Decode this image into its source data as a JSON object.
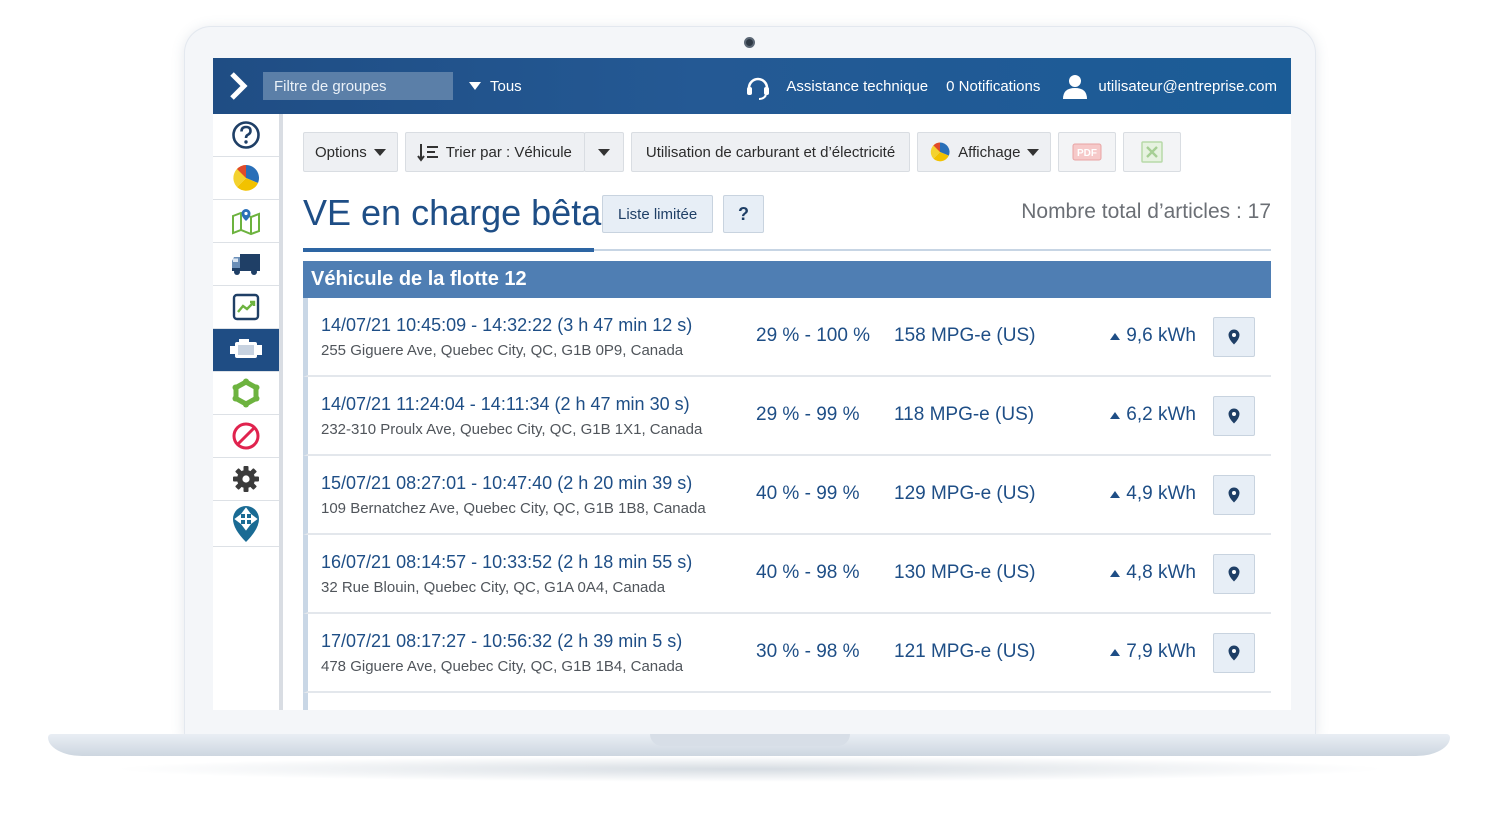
{
  "topbar": {
    "group_filter_placeholder": "Filtre de groupes",
    "all_label": "Tous",
    "support_label": "Assistance technique",
    "notifications_label": "0 Notifications",
    "user_email": "utilisateur@entreprise.com",
    "background_color": "#1f4d84"
  },
  "sidebar": {
    "items": [
      {
        "icon": "help-circle-icon"
      },
      {
        "icon": "pie-chart-icon"
      },
      {
        "icon": "map-icon"
      },
      {
        "icon": "truck-icon"
      },
      {
        "icon": "trend-chart-icon"
      },
      {
        "icon": "engine-icon",
        "active": true
      },
      {
        "icon": "zone-icon"
      },
      {
        "icon": "no-entry-icon"
      },
      {
        "icon": "gear-icon"
      },
      {
        "icon": "marketplace-icon"
      }
    ]
  },
  "toolbar": {
    "options_label": "Options",
    "sort_label": "Trier par : Véhicule",
    "fuel_label": "Utilisation de carburant et d’électricité",
    "display_label": "Affichage",
    "pdf_label": "PDF"
  },
  "page": {
    "title": "VE en charge bêta",
    "limited_list_label": "Liste limitée",
    "help_label": "?",
    "total_label": "Nombre total d’articles : 17"
  },
  "group": {
    "name": "Véhicule de la flotte 12",
    "header_color": "#4f7eb3"
  },
  "rows": [
    {
      "time": "14/07/21 10:45:09 - 14:32:22 (3 h 47 min 12 s)",
      "address": "255 Giguere Ave, Quebec City, QC, G1B 0P9, Canada",
      "charge": "29 % - 100 %",
      "mpg": "158 MPG-e (US)",
      "energy": "9,6 kWh"
    },
    {
      "time": "14/07/21 11:24:04 - 14:11:34 (2 h 47 min 30 s)",
      "address": "232-310 Proulx Ave, Quebec City, QC, G1B 1X1, Canada",
      "charge": "29 % - 99 %",
      "mpg": "118 MPG-e (US)",
      "energy": "6,2 kWh"
    },
    {
      "time": "15/07/21 08:27:01 - 10:47:40 (2 h 20 min 39 s)",
      "address": "109 Bernatchez Ave, Quebec City, QC, G1B 1B8, Canada",
      "charge": "40 % - 99 %",
      "mpg": "129 MPG-e (US)",
      "energy": "4,9 kWh"
    },
    {
      "time": "16/07/21 08:14:57 - 10:33:52 (2 h 18 min 55 s)",
      "address": "32 Rue Blouin, Quebec City, QC, G1A 0A4, Canada",
      "charge": "40 % - 98 %",
      "mpg": "130 MPG-e (US)",
      "energy": "4,8 kWh"
    },
    {
      "time": "17/07/21 08:17:27 - 10:56:32 (2 h 39 min 5 s)",
      "address": "478 Giguere Ave, Quebec City, QC, G1B 1B4, Canada",
      "charge": "30 % - 98 %",
      "mpg": "121 MPG-e (US)",
      "energy": "7,9 kWh"
    }
  ]
}
